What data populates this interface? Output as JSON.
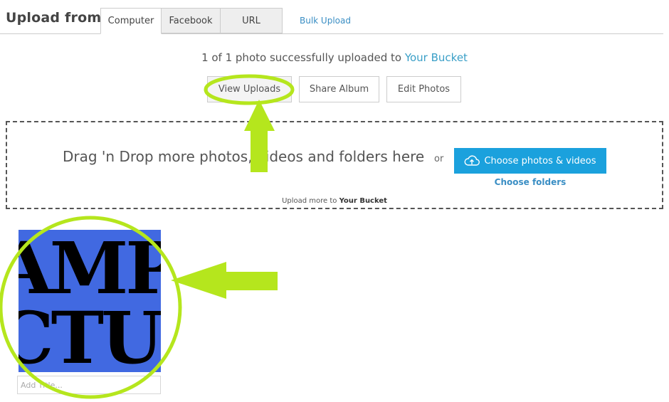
{
  "header": {
    "upload_from_label": "Upload from:",
    "tabs": [
      {
        "label": "Computer",
        "active": true
      },
      {
        "label": "Facebook",
        "active": false
      },
      {
        "label": "URL",
        "active": false
      }
    ],
    "bulk_upload_label": "Bulk Upload"
  },
  "status": {
    "prefix": "1 of 1 photo successfully uploaded to ",
    "bucket_link": "Your Bucket"
  },
  "actions": {
    "view_uploads": "View Uploads",
    "share_album": "Share Album",
    "edit_photos": "Edit Photos"
  },
  "dropzone": {
    "text": "Drag 'n Drop more photos, videos and folders here",
    "or": "or",
    "choose_button": "Choose photos & videos",
    "choose_folders": "Choose folders",
    "upload_more_prefix": "Upload more to ",
    "upload_more_bucket": "Your Bucket"
  },
  "thumbnail": {
    "image_text_line1": "AMP",
    "image_text_line2": "CTU",
    "title_placeholder": "Add Title...",
    "title_value": ""
  },
  "colors": {
    "accent_blue": "#1ba1dd",
    "link_blue": "#3a8ec4",
    "thumb_bg": "#4169e1",
    "annotation_green": "#b5e61d"
  },
  "icons": {
    "choose_button_icon": "cloud-upload-icon"
  }
}
